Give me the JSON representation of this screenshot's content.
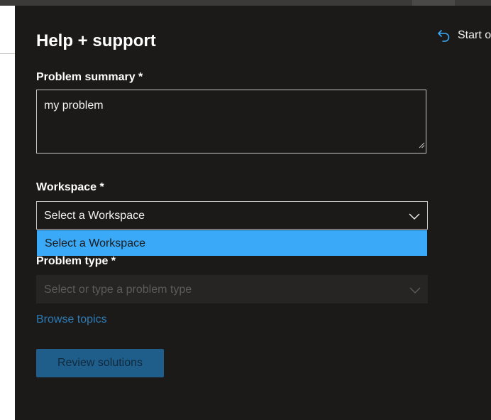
{
  "panel": {
    "title": "Help + support",
    "start_over_label": "Start over"
  },
  "form": {
    "summary_label": "Problem summary *",
    "summary_value": "my problem",
    "workspace_label": "Workspace *",
    "workspace_value": "Select a Workspace",
    "workspace_options": [
      "Select a Workspace"
    ],
    "problem_type_label": "Problem type *",
    "problem_type_placeholder": "Select or type a problem type",
    "browse_topics": "Browse topics",
    "review_button": "Review solutions"
  },
  "colors": {
    "background": "#1b1a19",
    "accent": "#3aa9f7",
    "button_disabled": "#1f5e8a",
    "link": "#2e7bb4"
  },
  "icons": {
    "start_over": "undo-icon",
    "dropdown": "chevron-down-icon"
  }
}
